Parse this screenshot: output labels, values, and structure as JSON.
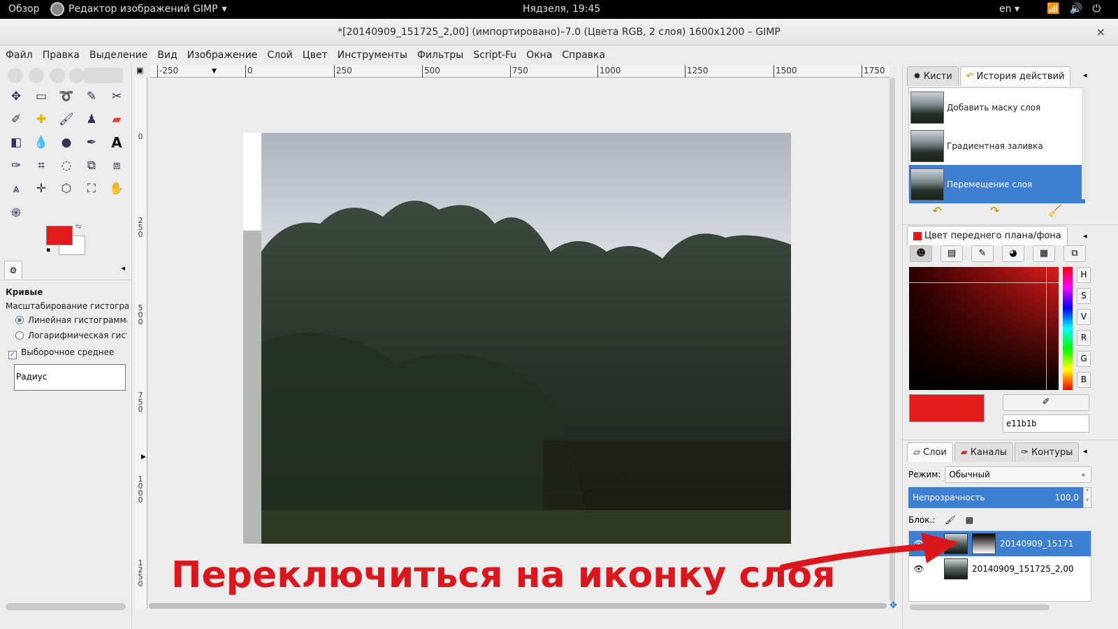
{
  "topbar": {
    "overview": "Обзор",
    "app_name": "Редактор изображений GIMP",
    "app_arrow": "▾",
    "clock": "Нядзеля, 19:45",
    "lang": "en",
    "lang_arrow": "▾"
  },
  "window": {
    "title": "*[20140909_151725_2,00] (импортировано)–7.0 (Цвета RGB, 2 слоя) 1600x1200 – GIMP",
    "close": "×"
  },
  "menu": [
    "Файл",
    "Правка",
    "Выделение",
    "Вид",
    "Изображение",
    "Слой",
    "Цвет",
    "Инструменты",
    "Фильтры",
    "Script-Fu",
    "Окна",
    "Справка"
  ],
  "tool_options": {
    "tool_name": "Кривые",
    "histogram_scale_label": "Масштабирование гистограммы",
    "linear": "Линейная гистограмма",
    "log": "Логарифмическая гистог",
    "sample_average": "Выборочное среднее",
    "radius": "Радиус"
  },
  "ruler_top": [
    "-250",
    "0",
    "250",
    "500",
    "750",
    "1000",
    "1250",
    "1500",
    "1750"
  ],
  "ruler_left": [
    "0",
    "250",
    "500",
    "750",
    "1000",
    "1250"
  ],
  "annotation": "Переключиться на иконку слоя",
  "dock": {
    "tab_brushes": "Кисти",
    "tab_history": "История действий",
    "history": [
      {
        "label": "Добавить маску слоя",
        "selected": false
      },
      {
        "label": "Градиентная заливка",
        "selected": false
      },
      {
        "label": "Перемещение слоя",
        "selected": true
      }
    ],
    "color_panel_title": "Цвет переднего плана/фона",
    "hsv_buttons": [
      "H",
      "S",
      "V",
      "R",
      "G",
      "B"
    ],
    "hex_value": "e11b1b",
    "tab_layers": "Слои",
    "tab_channels": "Каналы",
    "tab_paths": "Контуры",
    "mode_label": "Режим:",
    "mode_value": "Обычный",
    "opacity_label": "Непрозрачность",
    "opacity_value": "100,0",
    "lock_label": "Блок.:",
    "layers": [
      {
        "name": "20140909_15171",
        "selected": true
      },
      {
        "name": "20140909_151725_2,00",
        "selected": false
      }
    ]
  },
  "colors": {
    "foreground": "#e11b1b",
    "accent": "#3d7fd1",
    "annotation": "#d9171c"
  }
}
